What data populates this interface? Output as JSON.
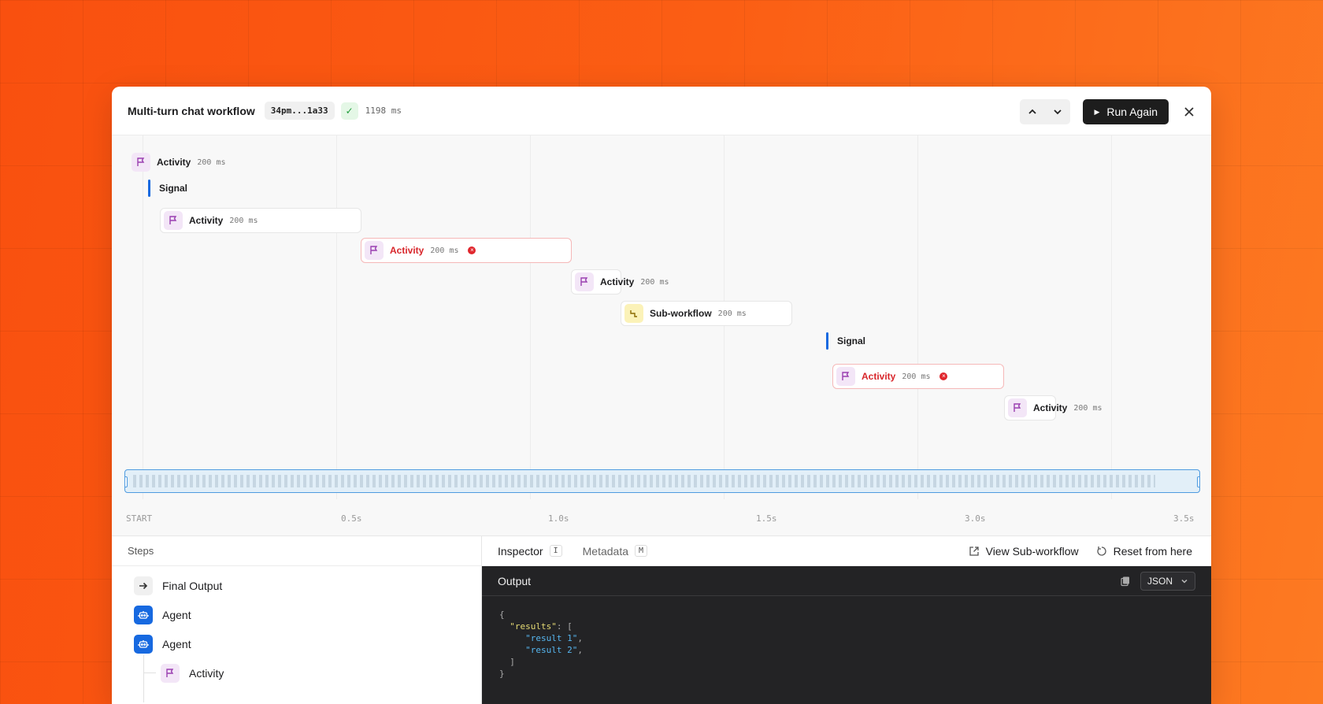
{
  "header": {
    "title": "Multi-turn chat workflow",
    "run_id": "34pm...1a33",
    "duration": "1198 ms",
    "run_again_label": "Run Again"
  },
  "timeline": {
    "steps": [
      {
        "type": "activity",
        "label": "Activity",
        "ms": "200 ms",
        "error": false
      },
      {
        "type": "signal",
        "label": "Signal"
      },
      {
        "type": "activity",
        "label": "Activity",
        "ms": "200 ms",
        "error": false
      },
      {
        "type": "activity",
        "label": "Activity",
        "ms": "200 ms",
        "error": true
      },
      {
        "type": "activity",
        "label": "Activity",
        "ms": "200 ms",
        "error": false
      },
      {
        "type": "sub-workflow",
        "label": "Sub-workflow",
        "ms": "200 ms",
        "error": false
      },
      {
        "type": "signal",
        "label": "Signal"
      },
      {
        "type": "activity",
        "label": "Activity",
        "ms": "200 ms",
        "error": true
      },
      {
        "type": "activity",
        "label": "Activity",
        "ms": "200 ms",
        "error": false
      }
    ],
    "axis": [
      "START",
      "0.5s",
      "1.0s",
      "1.5s",
      "3.0s",
      "3.5s"
    ]
  },
  "steps_panel": {
    "heading": "Steps",
    "items": [
      {
        "label": "Final Output",
        "icon": "arrow-right-icon"
      },
      {
        "label": "Agent",
        "icon": "robot-icon"
      },
      {
        "label": "Agent",
        "icon": "robot-icon"
      },
      {
        "label": "Activity",
        "icon": "flag-icon"
      }
    ]
  },
  "inspector": {
    "tabs": [
      {
        "label": "Inspector",
        "key": "I"
      },
      {
        "label": "Metadata",
        "key": "M"
      }
    ],
    "view_sub_workflow": "View Sub-workflow",
    "reset_from_here": "Reset from here",
    "output_title": "Output",
    "format": "JSON",
    "code": {
      "open": "{",
      "key": "\"results\"",
      "colon_bracket": ": [",
      "item1": "\"result 1\"",
      "item2": "\"result 2\"",
      "close_bracket": "]",
      "close": "}"
    }
  },
  "colors": {
    "accent_orange": "#fb5e14",
    "signal_blue": "#1769e0",
    "error_red": "#d8262b",
    "success_green": "#1e9b3a"
  }
}
